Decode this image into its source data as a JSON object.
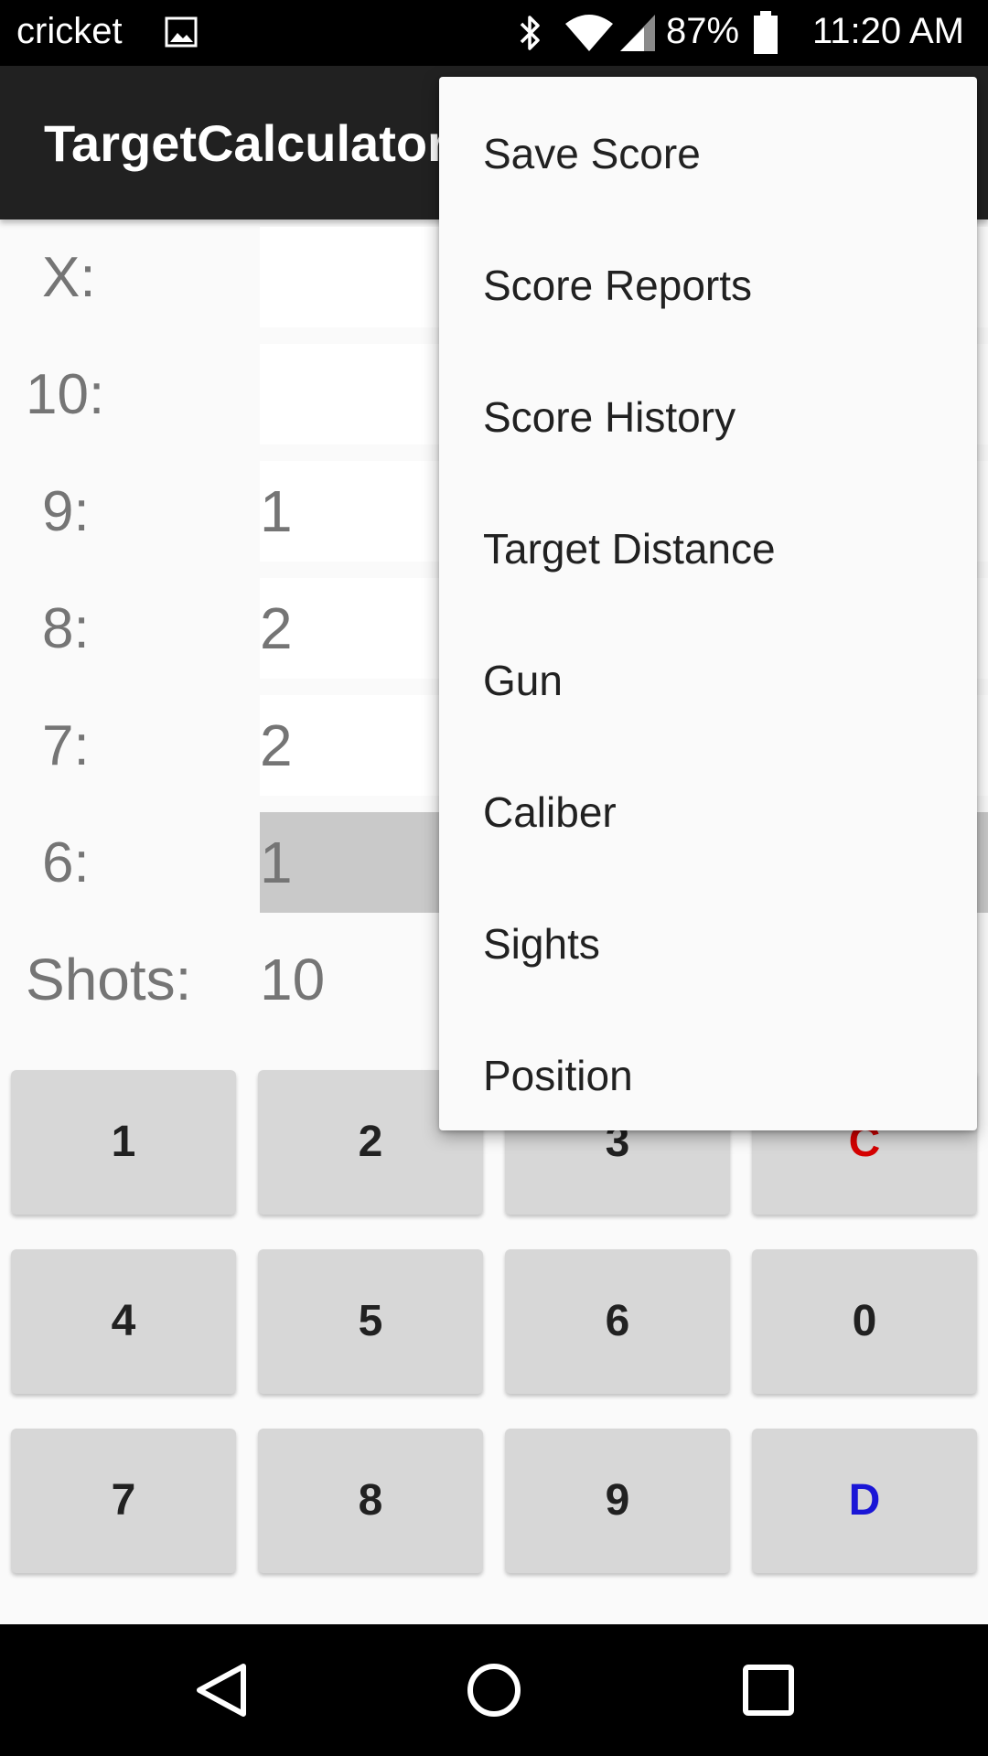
{
  "status_bar": {
    "carrier": "cricket",
    "battery_percent": "87%",
    "time": "11:20 AM",
    "icons": [
      "image-icon",
      "bluetooth-icon",
      "wifi-icon",
      "signal-icon",
      "battery-icon"
    ]
  },
  "app_bar": {
    "title": "TargetCalculator"
  },
  "score_rows": [
    {
      "label": "X:",
      "value": ""
    },
    {
      "label": "10:",
      "value": ""
    },
    {
      "label": "9:",
      "value": "1"
    },
    {
      "label": "8:",
      "value": "2"
    },
    {
      "label": "7:",
      "value": "2"
    },
    {
      "label": "6:",
      "value": "1"
    }
  ],
  "shots": {
    "label": "Shots:",
    "value": "10"
  },
  "keypad": [
    [
      "1",
      "2",
      "3",
      "C"
    ],
    [
      "4",
      "5",
      "6",
      "0"
    ],
    [
      "7",
      "8",
      "9",
      "D"
    ]
  ],
  "menu": {
    "items": [
      "Save Score",
      "Score Reports",
      "Score History",
      "Target Distance",
      "Gun",
      "Caliber",
      "Sights",
      "Position"
    ]
  },
  "nav_bar": {
    "icons": [
      "back-icon",
      "home-icon",
      "recents-icon"
    ]
  },
  "colors": {
    "app_bar": "#212121",
    "clear_key": "#d50000",
    "d_key": "#1a16d6",
    "active_field": "#c9c9c9"
  }
}
